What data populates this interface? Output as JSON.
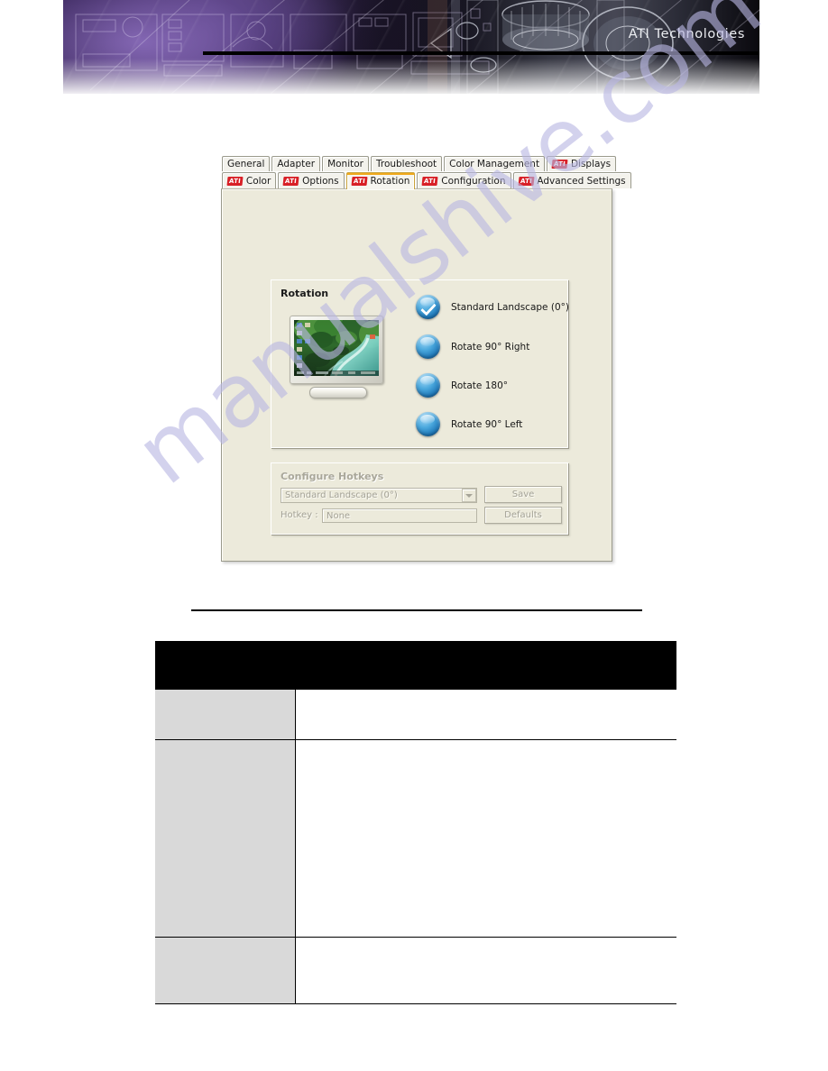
{
  "banner": {
    "title": "ATI Technologies",
    "brand_red": "#d81f26"
  },
  "watermark": {
    "text": "manualshive.com",
    "color": "#b9b7e3"
  },
  "dialog": {
    "tabs_row1": [
      {
        "label": "General",
        "ati": false,
        "active": false
      },
      {
        "label": "Adapter",
        "ati": false,
        "active": false
      },
      {
        "label": "Monitor",
        "ati": false,
        "active": false
      },
      {
        "label": "Troubleshoot",
        "ati": false,
        "active": false
      },
      {
        "label": "Color Management",
        "ati": false,
        "active": false
      },
      {
        "label": "Displays",
        "ati": true,
        "active": false
      }
    ],
    "tabs_row2": [
      {
        "label": "Color",
        "ati": true,
        "active": false
      },
      {
        "label": "Options",
        "ati": true,
        "active": false
      },
      {
        "label": "Rotation",
        "ati": true,
        "active": true
      },
      {
        "label": "Configuration",
        "ati": true,
        "active": false
      },
      {
        "label": "Advanced Settings",
        "ati": true,
        "active": false
      }
    ],
    "ati_logo_text": "ATI",
    "rotation_group": {
      "title": "Rotation",
      "options": [
        {
          "label": "Standard Landscape (0°)",
          "selected": true
        },
        {
          "label": "Rotate 90° Right",
          "selected": false
        },
        {
          "label": "Rotate 180°",
          "selected": false
        },
        {
          "label": "Rotate 90° Left",
          "selected": false
        }
      ]
    },
    "hotkeys_group": {
      "title": "Configure Hotkeys",
      "combo_value": "Standard Landscape (0°)",
      "hotkey_label": "Hotkey :",
      "hotkey_value": "None",
      "save_label": "Save",
      "defaults_label": "Defaults"
    }
  },
  "doc_table": {
    "header": "",
    "rows": [
      {
        "label": "",
        "body": ""
      },
      {
        "label": "",
        "body": ""
      },
      {
        "label": "",
        "body": ""
      }
    ]
  }
}
